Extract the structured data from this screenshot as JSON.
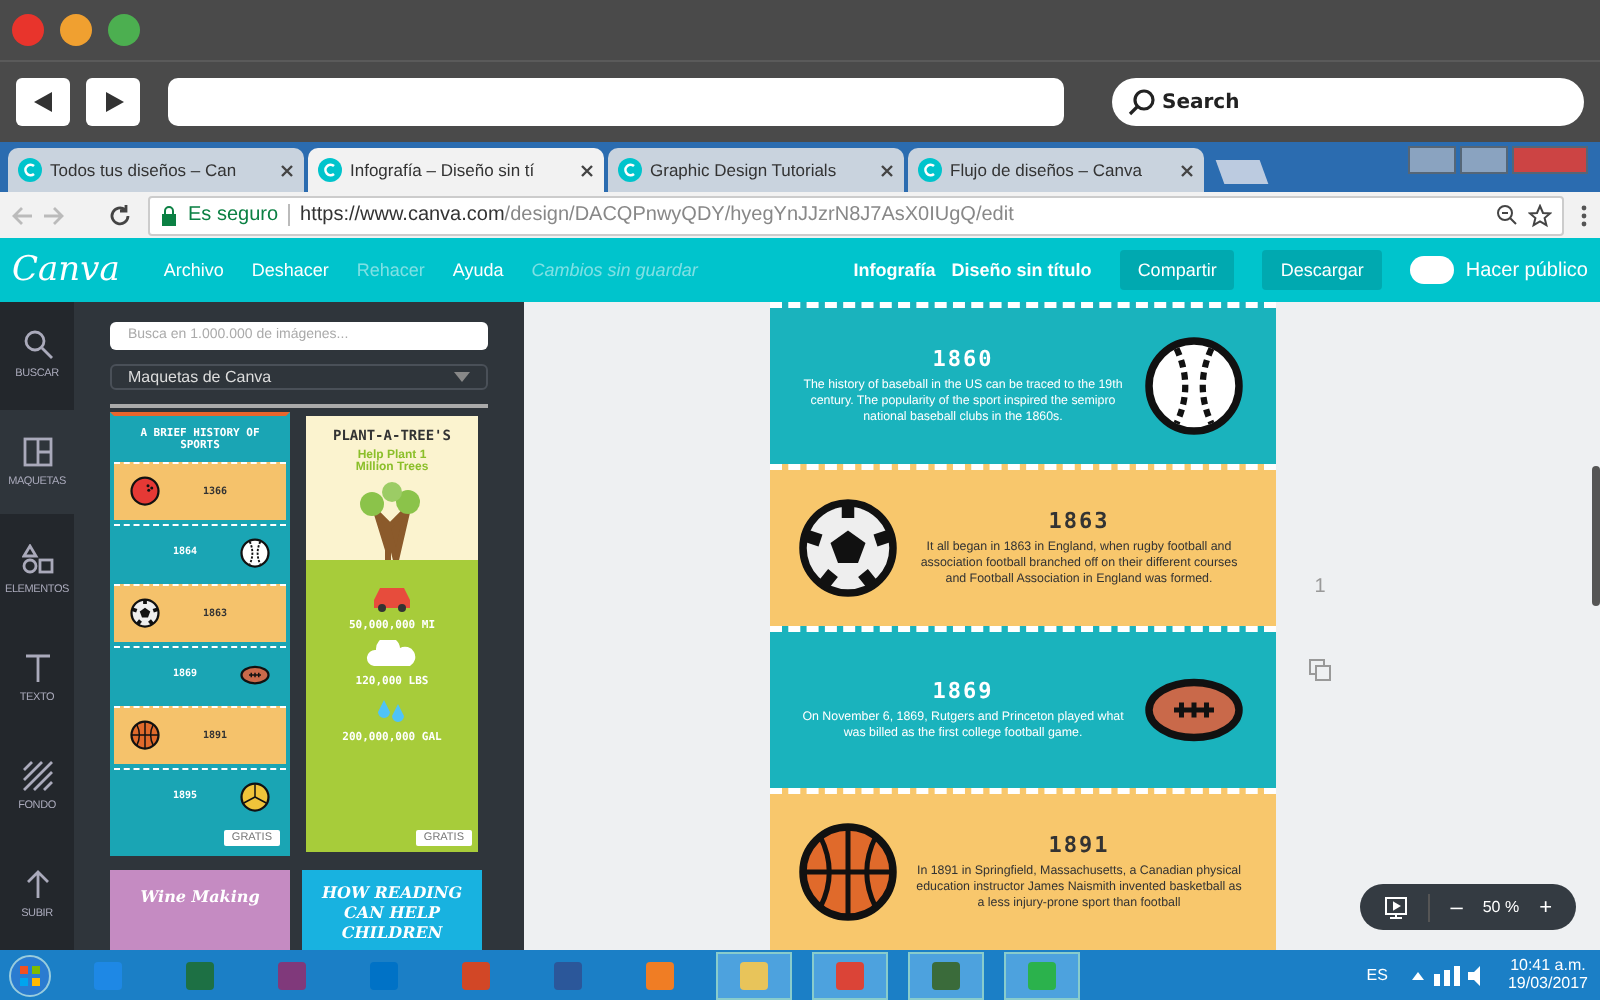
{
  "frame": {
    "search_placeholder": "Search"
  },
  "browser": {
    "tabs": [
      {
        "title": "Todos tus diseños – Can",
        "selected": false
      },
      {
        "title": "Infografía – Diseño sin tí",
        "selected": true
      },
      {
        "title": "Graphic Design Tutorials",
        "selected": false
      },
      {
        "title": "Flujo de diseños – Canva",
        "selected": false
      }
    ],
    "secure_label": "Es seguro",
    "url_host": "https://www.canva.com",
    "url_path": "/design/DACQPnwyQDY/hyegYnJJzrN8J7AsX0IUgQ/edit"
  },
  "canva": {
    "logo": "Canva",
    "menu": [
      {
        "label": "Archivo",
        "disabled": false
      },
      {
        "label": "Deshacer",
        "disabled": false
      },
      {
        "label": "Rehacer",
        "disabled": true
      },
      {
        "label": "Ayuda",
        "disabled": false
      }
    ],
    "status": "Cambios sin guardar",
    "doc_type": "Infografía",
    "doc_title": "Diseño sin título",
    "share": "Compartir",
    "download": "Descargar",
    "public": {
      "label": "Hacer público",
      "on": false
    }
  },
  "rail": [
    {
      "label": "BUSCAR",
      "kind": "search",
      "selected": false
    },
    {
      "label": "MAQUETAS",
      "kind": "layouts",
      "selected": true
    },
    {
      "label": "ELEMENTOS",
      "kind": "shapes",
      "selected": false
    },
    {
      "label": "TEXTO",
      "kind": "text",
      "selected": false
    },
    {
      "label": "FONDO",
      "kind": "pattern",
      "selected": false
    },
    {
      "label": "SUBIR",
      "kind": "upload",
      "selected": false
    }
  ],
  "panel": {
    "search_placeholder": "Busca en 1.000.000 de imágenes...",
    "dropdown": "Maquetas de Canva",
    "templates": [
      {
        "kind": "sports",
        "title": "A BRIEF HISTORY OF SPORTS",
        "selected": true,
        "badge": "GRATIS",
        "rows": [
          {
            "year": "1366",
            "kind": "bowling"
          },
          {
            "year": "1864",
            "kind": "baseball"
          },
          {
            "year": "1863",
            "kind": "soccer"
          },
          {
            "year": "1869",
            "kind": "football"
          },
          {
            "year": "1891",
            "kind": "basketball"
          },
          {
            "year": "1895",
            "kind": "volleyball"
          }
        ]
      },
      {
        "kind": "trees",
        "title": "PLANT-A-TREE'S",
        "subtitle": "Help Plant 1 Million Trees",
        "selected": false,
        "badge": "GRATIS",
        "stats": [
          "50,000,000 MI",
          "120,000 LBS",
          "200,000,000 GAL"
        ]
      },
      {
        "kind": "wine",
        "title": "Wine Making",
        "selected": false
      },
      {
        "kind": "reading",
        "title": "HOW READING CAN HELP CHILDREN",
        "selected": false
      }
    ]
  },
  "design": {
    "sections": [
      {
        "year": "1860",
        "kind": "baseball",
        "text": "The history of baseball in the US can be traced to the 19th century. The popularity of the sport inspired the semipro national baseball clubs in the 1860s."
      },
      {
        "year": "1863",
        "kind": "soccer",
        "text": "It all began in 1863 in England, when rugby football and association football branched off on their different courses and Football Association in England was formed."
      },
      {
        "year": "1869",
        "kind": "football",
        "text": "On November 6, 1869, Rutgers and Princeton played what was billed as the first college football game."
      },
      {
        "year": "1891",
        "kind": "basketball",
        "text": "In 1891 in Springfield, Massachusetts, a Canadian physical education instructor James Naismith invented basketball as a less injury-prone sport than football"
      }
    ],
    "page_number": "1",
    "zoom": "50 %",
    "zoom_out": "–",
    "zoom_in": "+"
  },
  "taskbar": {
    "apps": [
      {
        "color": "#1e88e5",
        "selected": false
      },
      {
        "color": "#1d7044",
        "selected": false
      },
      {
        "color": "#80397b",
        "selected": false
      },
      {
        "color": "#0072c6",
        "selected": false
      },
      {
        "color": "#d24726",
        "selected": false
      },
      {
        "color": "#2b579a",
        "selected": false
      },
      {
        "color": "#f07d24",
        "selected": false
      },
      {
        "color": "#e8c45a",
        "selected": true
      },
      {
        "color": "#db4437",
        "selected": true
      },
      {
        "color": "#3a6b3a",
        "selected": true
      },
      {
        "color": "#2bb24c",
        "selected": true
      }
    ],
    "language": "ES",
    "time": "10:41 a.m.",
    "date": "19/03/2017"
  }
}
